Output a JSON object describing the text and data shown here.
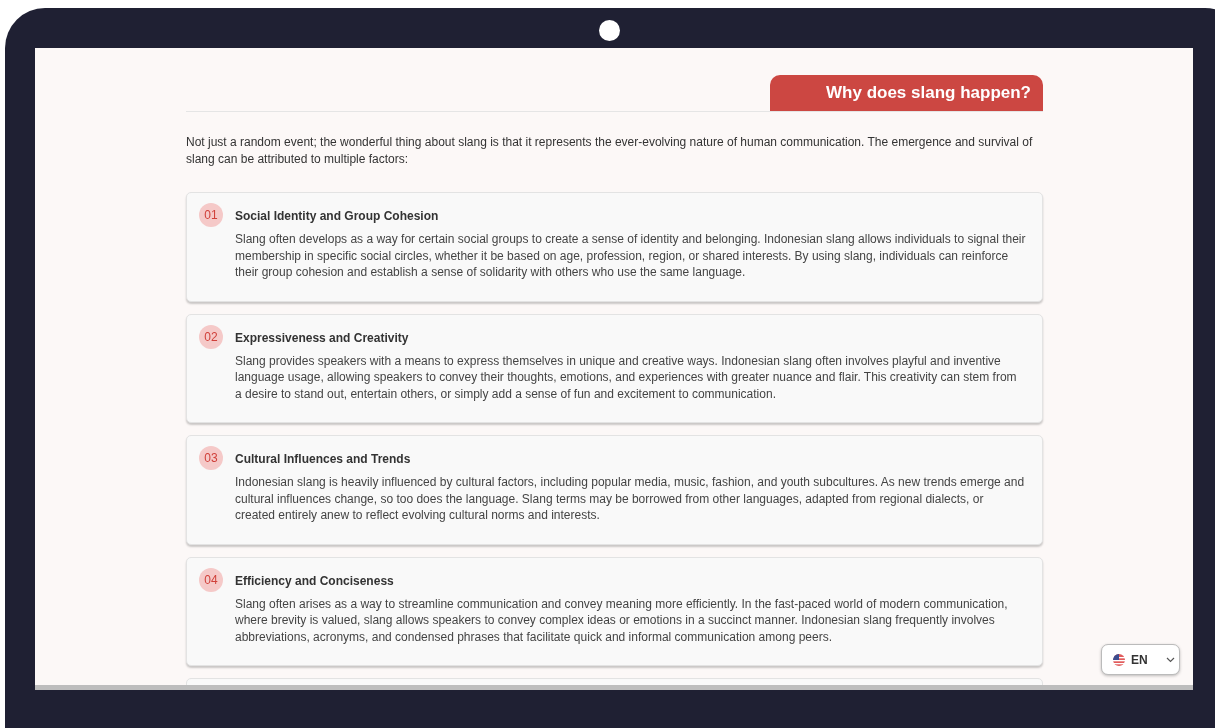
{
  "heading": "Why does slang happen?",
  "intro": "Not just a random event; the wonderful thing about slang is that it represents the ever-evolving nature of human communication. The emergence and survival of slang can be attributed to multiple factors:",
  "factors": [
    {
      "number": "01",
      "title": "Social Identity and Group Cohesion",
      "text": "Slang often develops as a way for certain social groups to create a sense of identity and belonging. Indonesian slang allows individuals to signal their membership in specific social circles, whether it be based on age, profession, region, or shared interests. By using slang, individuals can reinforce their group cohesion and establish a sense of solidarity with others who use the same language."
    },
    {
      "number": "02",
      "title": "Expressiveness and Creativity",
      "text": "Slang provides speakers with a means to express themselves in unique and creative ways. Indonesian slang often involves playful and inventive language usage, allowing speakers to convey their thoughts, emotions, and experiences with greater nuance and flair. This creativity can stem from a desire to stand out, entertain others, or simply add a sense of fun and excitement to communication."
    },
    {
      "number": "03",
      "title": "Cultural Influences and Trends",
      "text": "Indonesian slang is heavily influenced by cultural factors, including popular media, music, fashion, and youth subcultures. As new trends emerge and cultural influences change, so too does the language. Slang terms may be borrowed from other languages, adapted from regional dialects, or created entirely anew to reflect evolving cultural norms and interests."
    },
    {
      "number": "04",
      "title": "Efficiency and Conciseness",
      "text": "Slang often arises as a way to streamline communication and convey meaning more efficiently. In the fast-paced world of modern communication, where brevity is valued, slang allows speakers to convey complex ideas or emotions in a succinct manner. Indonesian slang frequently involves abbreviations, acronyms, and condensed phrases that facilitate quick and informal communication among peers."
    }
  ],
  "language_button": {
    "label": "EN"
  }
}
